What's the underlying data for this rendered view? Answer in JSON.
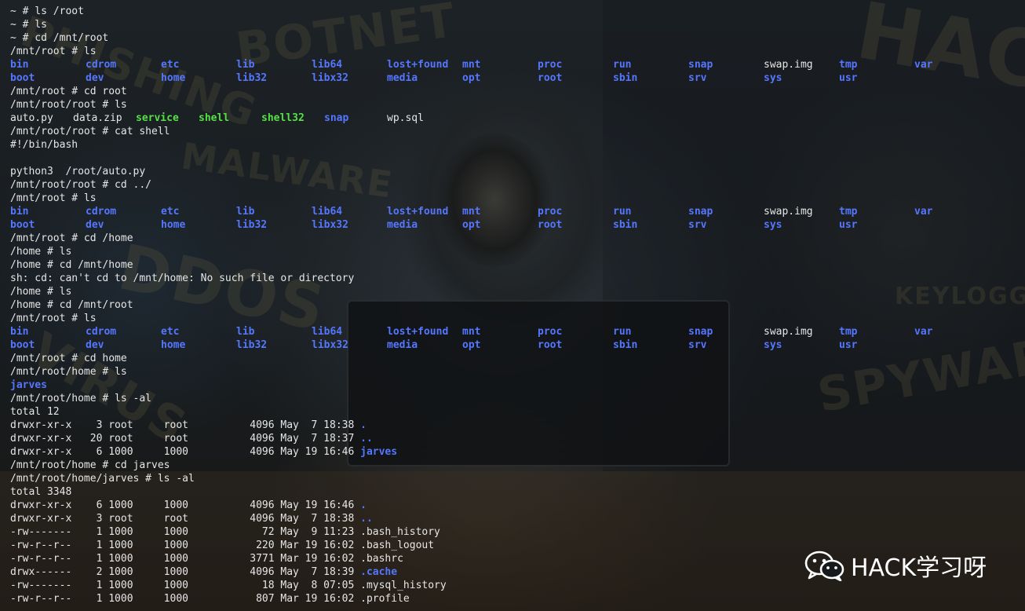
{
  "terminal": {
    "lines": [
      {
        "text": "~ # ls /root"
      },
      {
        "text": "~ # ls"
      },
      {
        "text": "~ # cd /mnt/root"
      },
      {
        "text": "/mnt/root # ls"
      },
      {
        "cols": [
          {
            "t": "bin",
            "c": "blue"
          },
          {
            "t": "cdrom",
            "c": "blue"
          },
          {
            "t": "etc",
            "c": "blue"
          },
          {
            "t": "lib",
            "c": "blue"
          },
          {
            "t": "lib64",
            "c": "blue"
          },
          {
            "t": "lost+found",
            "c": "blue"
          },
          {
            "t": "mnt",
            "c": "blue"
          },
          {
            "t": "proc",
            "c": "blue"
          },
          {
            "t": "run",
            "c": "blue"
          },
          {
            "t": "snap",
            "c": "blue"
          },
          {
            "t": "swap.img",
            "c": "white"
          },
          {
            "t": "tmp",
            "c": "blue"
          },
          {
            "t": "var",
            "c": "blue"
          }
        ]
      },
      {
        "cols": [
          {
            "t": "boot",
            "c": "blue"
          },
          {
            "t": "dev",
            "c": "blue"
          },
          {
            "t": "home",
            "c": "blue"
          },
          {
            "t": "lib32",
            "c": "blue"
          },
          {
            "t": "libx32",
            "c": "blue"
          },
          {
            "t": "media",
            "c": "blue"
          },
          {
            "t": "opt",
            "c": "blue"
          },
          {
            "t": "root",
            "c": "blue"
          },
          {
            "t": "sbin",
            "c": "blue"
          },
          {
            "t": "srv",
            "c": "blue"
          },
          {
            "t": "sys",
            "c": "blue"
          },
          {
            "t": "usr",
            "c": "blue"
          }
        ]
      },
      {
        "text": "/mnt/root # cd root"
      },
      {
        "text": "/mnt/root/root # ls"
      },
      {
        "cols_x": [
          0,
          80,
          160,
          240,
          320,
          400,
          480
        ],
        "cols": [
          {
            "t": "auto.py",
            "c": "white"
          },
          {
            "t": "data.zip",
            "c": "white"
          },
          {
            "t": "service",
            "c": "green"
          },
          {
            "t": "shell",
            "c": "green"
          },
          {
            "t": "shell32",
            "c": "green"
          },
          {
            "t": "snap",
            "c": "blue"
          },
          {
            "t": "wp.sql",
            "c": "white"
          }
        ]
      },
      {
        "text": "/mnt/root/root # cat shell"
      },
      {
        "text": "#!/bin/bash"
      },
      {
        "text": ""
      },
      {
        "text": "python3  /root/auto.py"
      },
      {
        "text": "/mnt/root/root # cd ../"
      },
      {
        "text": "/mnt/root # ls"
      },
      {
        "cols": [
          {
            "t": "bin",
            "c": "blue"
          },
          {
            "t": "cdrom",
            "c": "blue"
          },
          {
            "t": "etc",
            "c": "blue"
          },
          {
            "t": "lib",
            "c": "blue"
          },
          {
            "t": "lib64",
            "c": "blue"
          },
          {
            "t": "lost+found",
            "c": "blue"
          },
          {
            "t": "mnt",
            "c": "blue"
          },
          {
            "t": "proc",
            "c": "blue"
          },
          {
            "t": "run",
            "c": "blue"
          },
          {
            "t": "snap",
            "c": "blue"
          },
          {
            "t": "swap.img",
            "c": "white"
          },
          {
            "t": "tmp",
            "c": "blue"
          },
          {
            "t": "var",
            "c": "blue"
          }
        ]
      },
      {
        "cols": [
          {
            "t": "boot",
            "c": "blue"
          },
          {
            "t": "dev",
            "c": "blue"
          },
          {
            "t": "home",
            "c": "blue"
          },
          {
            "t": "lib32",
            "c": "blue"
          },
          {
            "t": "libx32",
            "c": "blue"
          },
          {
            "t": "media",
            "c": "blue"
          },
          {
            "t": "opt",
            "c": "blue"
          },
          {
            "t": "root",
            "c": "blue"
          },
          {
            "t": "sbin",
            "c": "blue"
          },
          {
            "t": "srv",
            "c": "blue"
          },
          {
            "t": "sys",
            "c": "blue"
          },
          {
            "t": "usr",
            "c": "blue"
          }
        ]
      },
      {
        "text": "/mnt/root # cd /home"
      },
      {
        "text": "/home # ls"
      },
      {
        "text": "/home # cd /mnt/home"
      },
      {
        "text": "sh: cd: can't cd to /mnt/home: No such file or directory"
      },
      {
        "text": "/home # ls"
      },
      {
        "text": "/home # cd /mnt/root"
      },
      {
        "text": "/mnt/root # ls"
      },
      {
        "cols": [
          {
            "t": "bin",
            "c": "blue"
          },
          {
            "t": "cdrom",
            "c": "blue"
          },
          {
            "t": "etc",
            "c": "blue"
          },
          {
            "t": "lib",
            "c": "blue"
          },
          {
            "t": "lib64",
            "c": "blue"
          },
          {
            "t": "lost+found",
            "c": "blue"
          },
          {
            "t": "mnt",
            "c": "blue"
          },
          {
            "t": "proc",
            "c": "blue"
          },
          {
            "t": "run",
            "c": "blue"
          },
          {
            "t": "snap",
            "c": "blue"
          },
          {
            "t": "swap.img",
            "c": "white"
          },
          {
            "t": "tmp",
            "c": "blue"
          },
          {
            "t": "var",
            "c": "blue"
          }
        ]
      },
      {
        "cols": [
          {
            "t": "boot",
            "c": "blue"
          },
          {
            "t": "dev",
            "c": "blue"
          },
          {
            "t": "home",
            "c": "blue"
          },
          {
            "t": "lib32",
            "c": "blue"
          },
          {
            "t": "libx32",
            "c": "blue"
          },
          {
            "t": "media",
            "c": "blue"
          },
          {
            "t": "opt",
            "c": "blue"
          },
          {
            "t": "root",
            "c": "blue"
          },
          {
            "t": "sbin",
            "c": "blue"
          },
          {
            "t": "srv",
            "c": "blue"
          },
          {
            "t": "sys",
            "c": "blue"
          },
          {
            "t": "usr",
            "c": "blue"
          }
        ]
      },
      {
        "text": "/mnt/root # cd home"
      },
      {
        "text": "/mnt/root/home # ls"
      },
      {
        "cols": [
          {
            "t": "jarves",
            "c": "blue"
          }
        ]
      },
      {
        "text": "/mnt/root/home # ls -al"
      },
      {
        "text": "total 12"
      },
      {
        "pre": "drwxr-xr-x    3 root     root          4096 May  7 18:38 ",
        "name": ".",
        "c": "blue"
      },
      {
        "pre": "drwxr-xr-x   20 root     root          4096 May  7 18:37 ",
        "name": "..",
        "c": "blue"
      },
      {
        "pre": "drwxr-xr-x    6 1000     1000          4096 May 19 16:46 ",
        "name": "jarves",
        "c": "blue"
      },
      {
        "text": "/mnt/root/home # cd jarves"
      },
      {
        "text": "/mnt/root/home/jarves # ls -al"
      },
      {
        "text": "total 3348"
      },
      {
        "pre": "drwxr-xr-x    6 1000     1000          4096 May 19 16:46 ",
        "name": ".",
        "c": "blue"
      },
      {
        "pre": "drwxr-xr-x    3 root     root          4096 May  7 18:38 ",
        "name": "..",
        "c": "blue"
      },
      {
        "pre": "-rw-------    1 1000     1000            72 May  9 11:23 ",
        "name": ".bash_history",
        "c": "white"
      },
      {
        "pre": "-rw-r--r--    1 1000     1000           220 Mar 19 16:02 ",
        "name": ".bash_logout",
        "c": "white"
      },
      {
        "pre": "-rw-r--r--    1 1000     1000          3771 Mar 19 16:02 ",
        "name": ".bashrc",
        "c": "white"
      },
      {
        "pre": "drwx------    2 1000     1000          4096 May  7 18:39 ",
        "name": ".cache",
        "c": "blue"
      },
      {
        "pre": "-rw-------    1 1000     1000            18 May  8 07:05 ",
        "name": ".mysql_history",
        "c": "white"
      },
      {
        "pre": "-rw-r--r--    1 1000     1000           807 Mar 19 16:02 ",
        "name": ".profile",
        "c": "white"
      }
    ]
  },
  "watermark": {
    "text": "HACK学习呀",
    "icon": "wechat-icon"
  },
  "colors": {
    "dir": "#5577ff",
    "exec": "#55e046",
    "text": "#e6e6e6",
    "background": "#15191c"
  }
}
